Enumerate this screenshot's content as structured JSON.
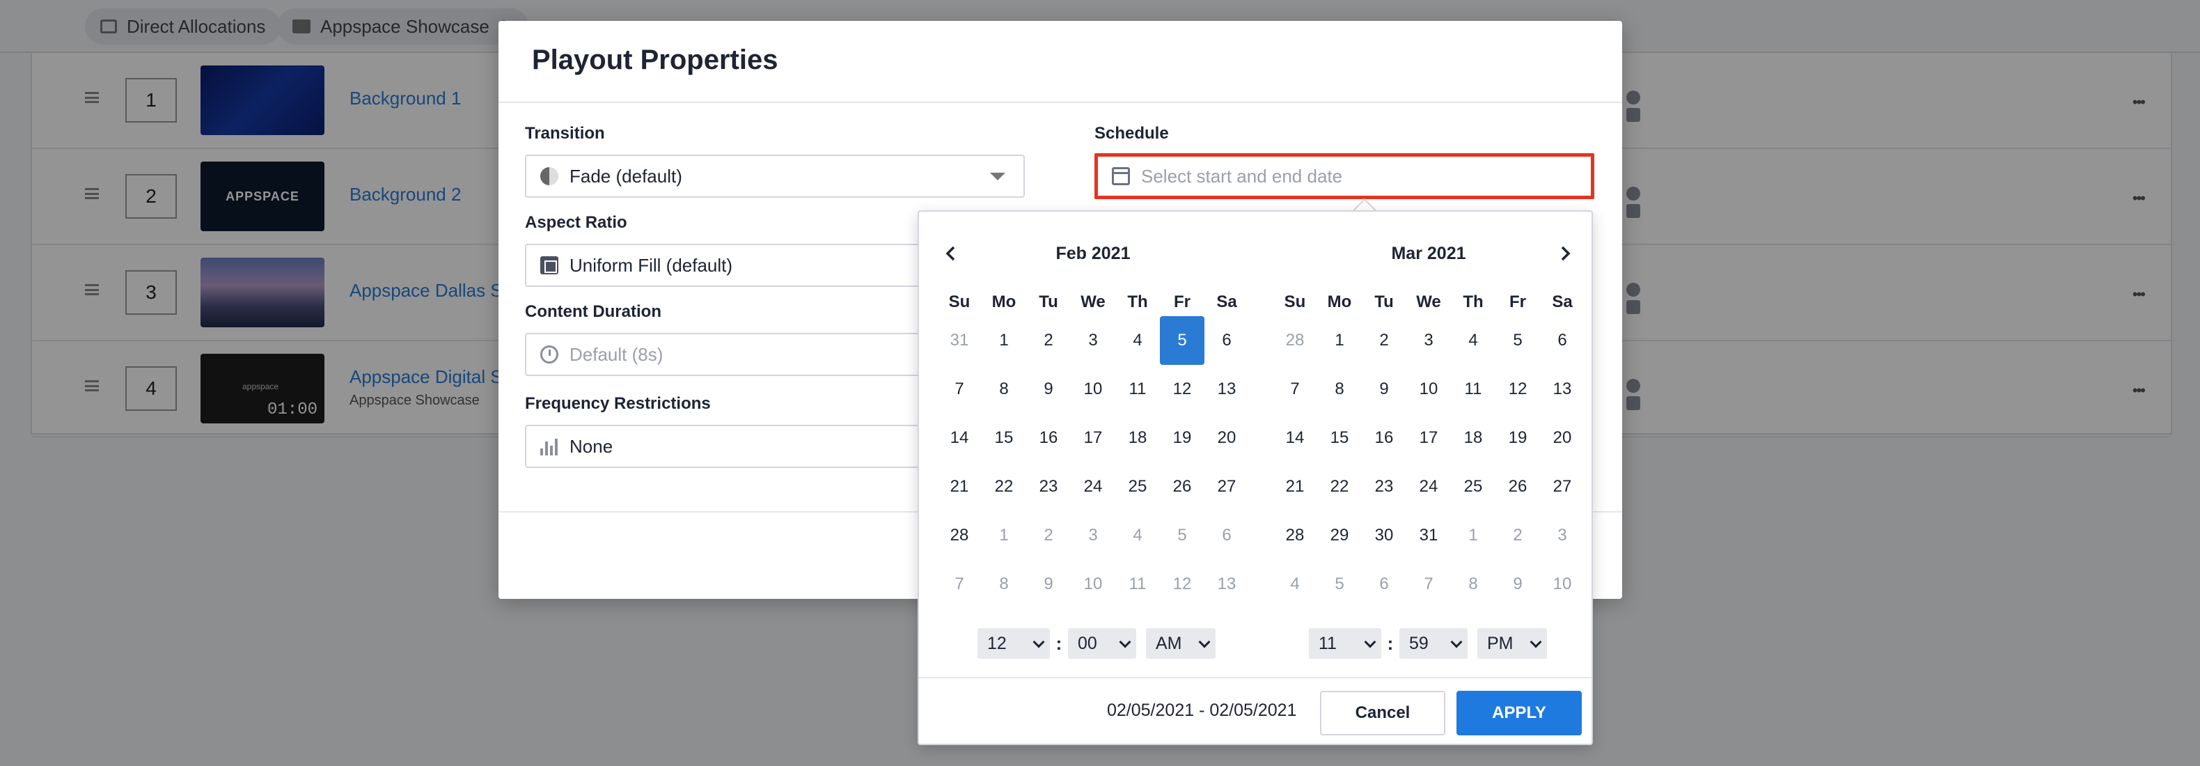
{
  "breadcrumb": {
    "chips": [
      {
        "label": "Direct Allocations",
        "icon": "image-icon"
      },
      {
        "label": "Appspace Showcase",
        "icon": "folder-icon"
      }
    ]
  },
  "content_rows": [
    {
      "order": "1",
      "title": "Background 1",
      "subtitle": ""
    },
    {
      "order": "2",
      "title": "Background 2",
      "subtitle": "",
      "thumb_text": "APPSPACE"
    },
    {
      "order": "3",
      "title": "Appspace Dallas Sky",
      "subtitle": ""
    },
    {
      "order": "4",
      "title": "Appspace Digital Sig",
      "subtitle": "Appspace Showcase",
      "thumb_text": "appspace",
      "duration": "01:00"
    }
  ],
  "modal": {
    "title": "Playout Properties",
    "transition": {
      "label": "Transition",
      "value": "Fade (default)"
    },
    "aspect_ratio": {
      "label": "Aspect Ratio",
      "value": "Uniform Fill (default)"
    },
    "content_duration": {
      "label": "Content Duration",
      "placeholder": "Default (8s)"
    },
    "frequency": {
      "label": "Frequency Restrictions",
      "value": "None"
    },
    "schedule": {
      "label": "Schedule",
      "placeholder": "Select start and end date"
    }
  },
  "datepicker": {
    "days_of_week": [
      "Su",
      "Mo",
      "Tu",
      "We",
      "Th",
      "Fr",
      "Sa"
    ],
    "months": [
      {
        "title": "Feb 2021",
        "weeks": [
          [
            "31",
            "1",
            "2",
            "3",
            "4",
            "5",
            "6"
          ],
          [
            "7",
            "8",
            "9",
            "10",
            "11",
            "12",
            "13"
          ],
          [
            "14",
            "15",
            "16",
            "17",
            "18",
            "19",
            "20"
          ],
          [
            "21",
            "22",
            "23",
            "24",
            "25",
            "26",
            "27"
          ],
          [
            "28",
            "1",
            "2",
            "3",
            "4",
            "5",
            "6"
          ],
          [
            "7",
            "8",
            "9",
            "10",
            "11",
            "12",
            "13"
          ]
        ],
        "selected_day": "5",
        "time": {
          "hour": "12",
          "minute": "00",
          "ampm": "AM"
        }
      },
      {
        "title": "Mar 2021",
        "weeks": [
          [
            "28",
            "1",
            "2",
            "3",
            "4",
            "5",
            "6"
          ],
          [
            "7",
            "8",
            "9",
            "10",
            "11",
            "12",
            "13"
          ],
          [
            "14",
            "15",
            "16",
            "17",
            "18",
            "19",
            "20"
          ],
          [
            "21",
            "22",
            "23",
            "24",
            "25",
            "26",
            "27"
          ],
          [
            "28",
            "29",
            "30",
            "31",
            "1",
            "2",
            "3"
          ],
          [
            "4",
            "5",
            "6",
            "7",
            "8",
            "9",
            "10"
          ]
        ],
        "selected_day": null,
        "time": {
          "hour": "11",
          "minute": "59",
          "ampm": "PM"
        }
      }
    ],
    "range_text": "02/05/2021 - 02/05/2021",
    "cancel_label": "Cancel",
    "apply_label": "APPLY"
  },
  "colors": {
    "accent": "#1f7ae0",
    "selected_day": "#2a7bd4",
    "highlight_border": "#e53322"
  }
}
